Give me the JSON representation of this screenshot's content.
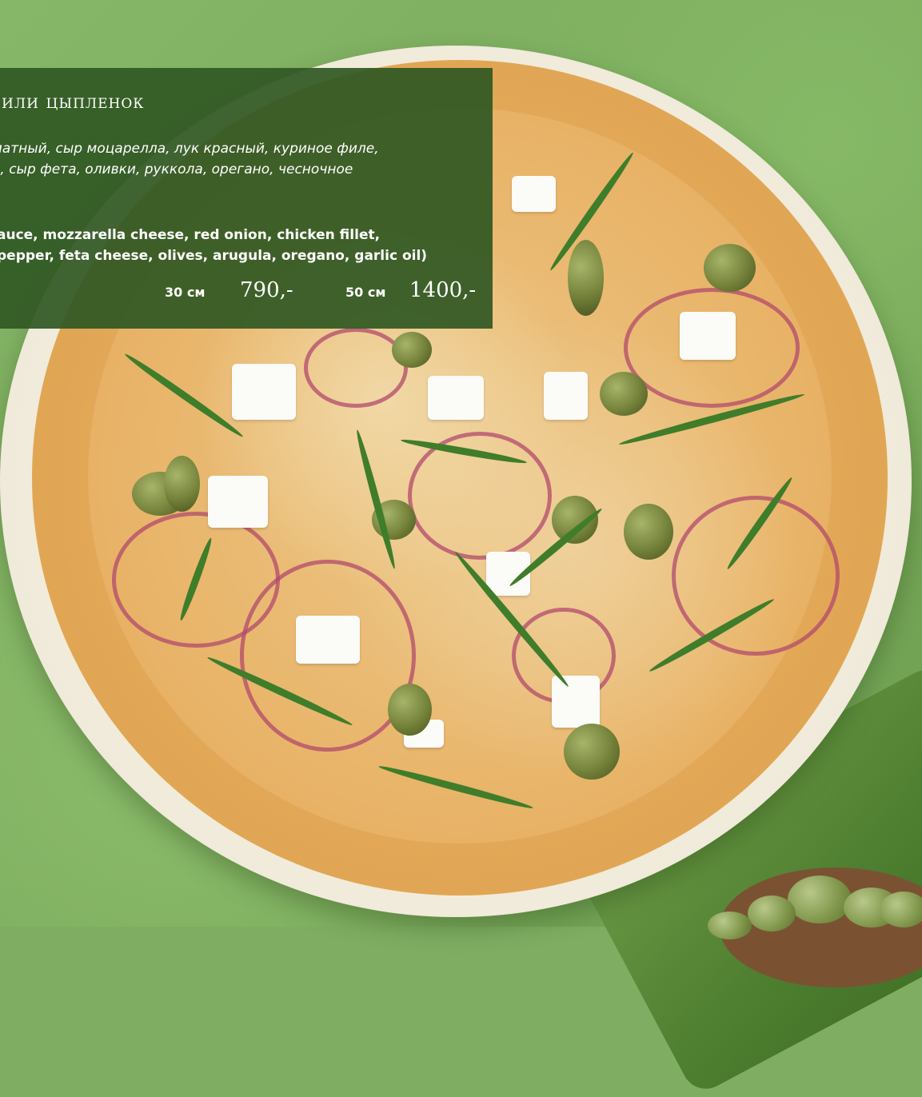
{
  "menu_item": {
    "title": "а Чили цыпленок",
    "description_ru": [
      "матный, сыр моцарелла, лук красный, куриное филе,",
      "о, сыр фета, оливки, руккола, орегано, чесночное"
    ],
    "description_en": [
      "auce, mozzarella cheese, red onion, chicken fillet,",
      "pepper, feta cheese, olives, arugula, oregano, garlic oil)"
    ],
    "sizes": [
      {
        "size": "30 см",
        "price": "790,-"
      },
      {
        "size": "50 см",
        "price": "1400,-"
      }
    ]
  },
  "colors": {
    "panel_background": "#315824",
    "panel_text": "#ffffff",
    "background": "#7fae62"
  }
}
